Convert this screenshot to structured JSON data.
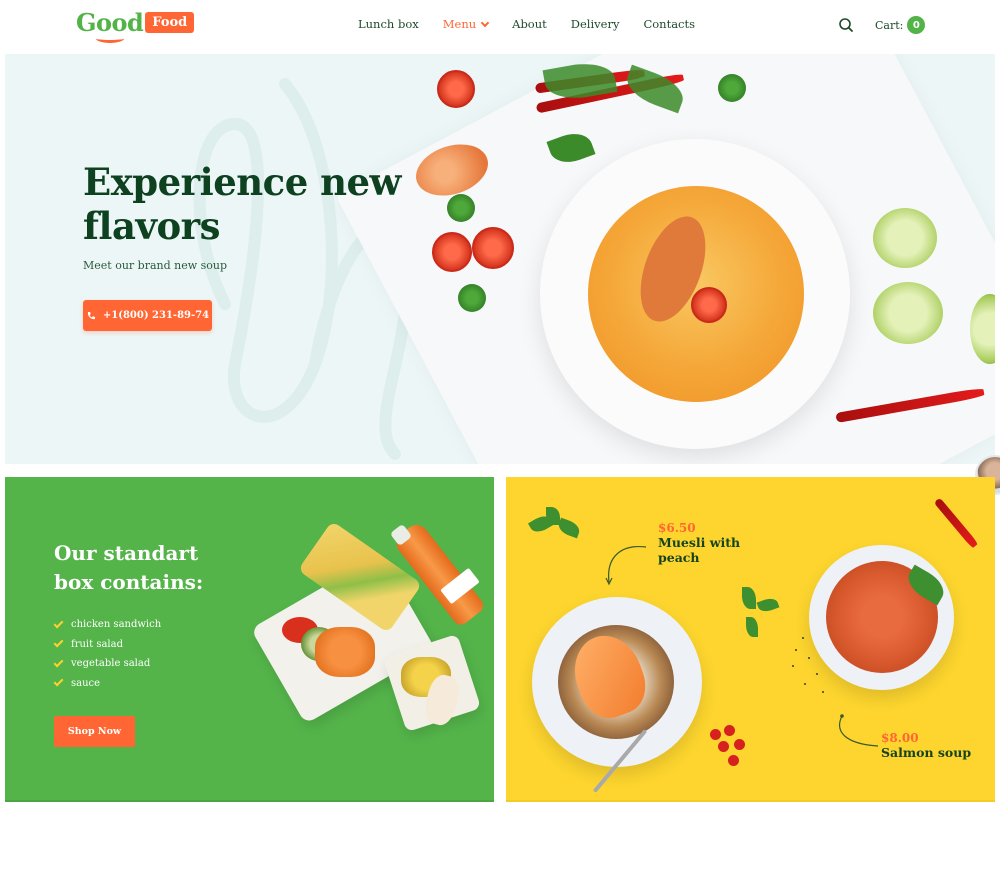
{
  "header": {
    "logo": {
      "word1": "Good",
      "word2": "Food"
    },
    "nav": [
      {
        "label": "Lunch box",
        "active": false
      },
      {
        "label": "Menu",
        "active": true,
        "has_dropdown": true
      },
      {
        "label": "About",
        "active": false
      },
      {
        "label": "Delivery",
        "active": false
      },
      {
        "label": "Contacts",
        "active": false
      }
    ],
    "search_icon": "search-icon",
    "cart": {
      "label": "Cart:",
      "count": "0"
    }
  },
  "hero": {
    "title": "Experience new flavors",
    "subtitle": "Meet our brand new soup",
    "phone_button": {
      "icon": "phone-icon",
      "label": "+1(800) 231-89-74"
    }
  },
  "lunchbox_card": {
    "title": "Our standart box contains:",
    "items": [
      "chicken sandwich",
      "fruit salad",
      "vegetable salad",
      "sauce"
    ],
    "button": "Shop Now"
  },
  "dishes_card": {
    "dishes": [
      {
        "price": "$6.50",
        "name": "Muesli with peach"
      },
      {
        "price": "$8.00",
        "name": "Salmon soup"
      }
    ]
  },
  "colors": {
    "brand_green": "#52b347",
    "accent_orange": "#ff6633",
    "dark_green_text": "#0d4120",
    "hero_bg": "#ecf6f7",
    "card_green": "#54b44a",
    "card_yellow": "#fdd52e",
    "check_yellow": "#ffd12e"
  }
}
